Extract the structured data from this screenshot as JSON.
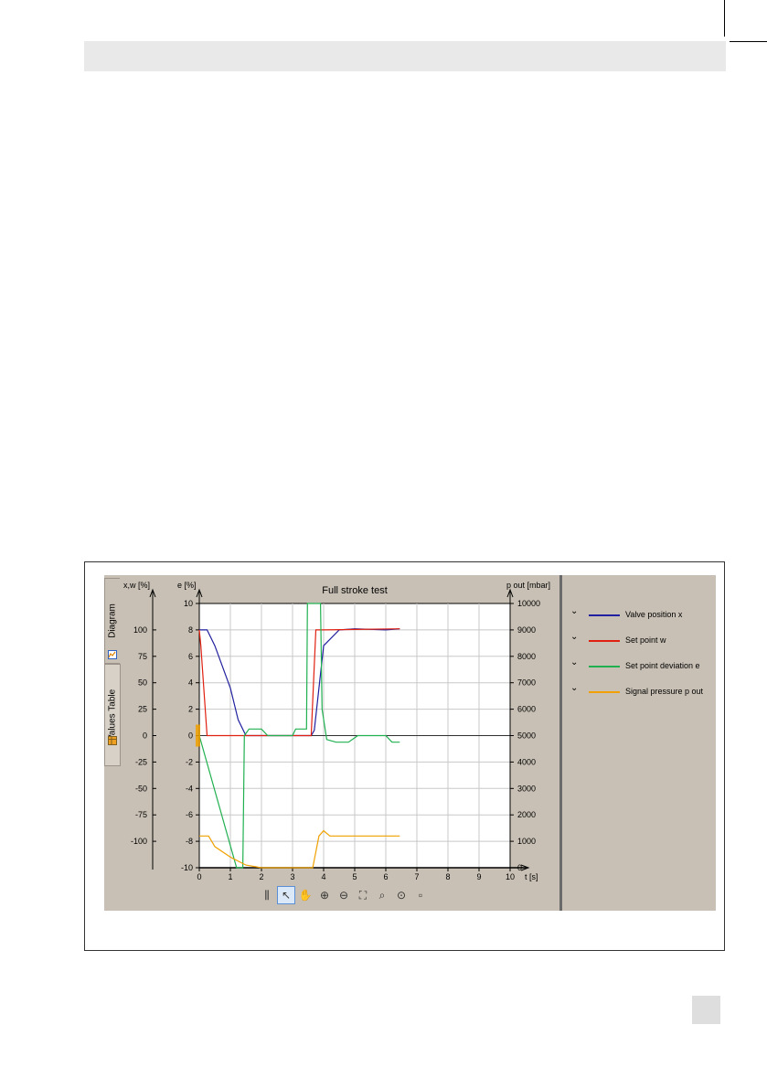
{
  "tabs": {
    "diagram": "Diagram",
    "values_table": "Values Table"
  },
  "chart_data": {
    "type": "line",
    "title": "Full stroke test",
    "xlabel": "t [s]",
    "axes_labels": {
      "left_outer": "x,w [%]",
      "left_inner": "e [%]",
      "right": "p out [mbar]"
    },
    "xlim": [
      0,
      10
    ],
    "x_ticks": [
      0,
      1,
      2,
      3,
      4,
      5,
      6,
      7,
      8,
      9,
      10
    ],
    "xw_ylim": [
      -125,
      125
    ],
    "xw_ticks": [
      100,
      75,
      50,
      25,
      0,
      -25,
      -50,
      -75,
      -100
    ],
    "e_ylim": [
      -10,
      10
    ],
    "e_ticks": [
      10,
      8,
      6,
      4,
      2,
      0,
      -2,
      -4,
      -6,
      -8,
      -10
    ],
    "p_ylim": [
      0,
      10000
    ],
    "p_ticks": [
      10000,
      9000,
      8000,
      7000,
      6000,
      5000,
      4000,
      3000,
      2000,
      1000,
      0
    ],
    "grid": true,
    "series": [
      {
        "name": "Valve position x",
        "color": "#2020a0",
        "axis": "xw",
        "x": [
          0,
          0.25,
          0.5,
          1.0,
          1.25,
          1.5,
          2.0,
          3.0,
          3.6,
          3.7,
          4.0,
          4.5,
          5.0,
          6.0,
          6.45
        ],
        "y": [
          100,
          100,
          85,
          45,
          15,
          0,
          0,
          0,
          0,
          5,
          85,
          100,
          101,
          100,
          101
        ]
      },
      {
        "name": "Set point w",
        "color": "#e02010",
        "axis": "xw",
        "x": [
          0,
          0.05,
          0.25,
          0.35,
          3.6,
          3.75,
          4.0,
          6.45
        ],
        "y": [
          100,
          85,
          0,
          0,
          0,
          100,
          100,
          101
        ]
      },
      {
        "name": "Set point deviation e",
        "color": "#20b050",
        "axis": "e",
        "x": [
          0,
          1.2,
          1.4,
          1.45,
          1.6,
          2.0,
          2.2,
          3.0,
          3.1,
          3.45,
          3.48,
          3.52,
          3.9,
          3.95,
          4.1,
          4.4,
          4.8,
          5.1,
          6.0,
          6.2,
          6.45
        ],
        "y": [
          0,
          -10,
          -10,
          0,
          0.5,
          0.5,
          0,
          0,
          0.5,
          0.5,
          10,
          10,
          10,
          2,
          -0.3,
          -0.5,
          -0.5,
          0,
          0,
          -0.5,
          -0.5
        ]
      },
      {
        "name": "Signal pressure p out",
        "color": "#f0a000",
        "axis": "p",
        "x": [
          0,
          0.3,
          0.5,
          1.0,
          1.5,
          2.0,
          3.0,
          3.65,
          3.85,
          4.0,
          4.2,
          5.0,
          6.45
        ],
        "y": [
          1200,
          1200,
          800,
          400,
          100,
          0,
          0,
          0,
          1200,
          1400,
          1200,
          1200,
          1200
        ]
      }
    ]
  },
  "legend": [
    {
      "label": "Valve position x",
      "color": "#2020a0"
    },
    {
      "label": "Set point w",
      "color": "#e02010"
    },
    {
      "label": "Set point deviation e",
      "color": "#20b050"
    },
    {
      "label": "Signal pressure p out",
      "color": "#f0a000"
    }
  ],
  "toolbar": [
    {
      "name": "cursor-lock-tool-icon",
      "glyph": "⫼"
    },
    {
      "name": "select-pointer-tool-icon",
      "glyph": "↖"
    },
    {
      "name": "pan-hand-tool-icon",
      "glyph": "✋"
    },
    {
      "name": "zoom-in-tool-icon",
      "glyph": "⊕"
    },
    {
      "name": "zoom-out-tool-icon",
      "glyph": "⊖"
    },
    {
      "name": "zoom-fit-tool-icon",
      "glyph": "⛶"
    },
    {
      "name": "zoom-region-tool-icon",
      "glyph": "⌕"
    },
    {
      "name": "zoom-reset-tool-icon",
      "glyph": "⊙"
    },
    {
      "name": "export-tool-icon",
      "glyph": "▫"
    }
  ]
}
